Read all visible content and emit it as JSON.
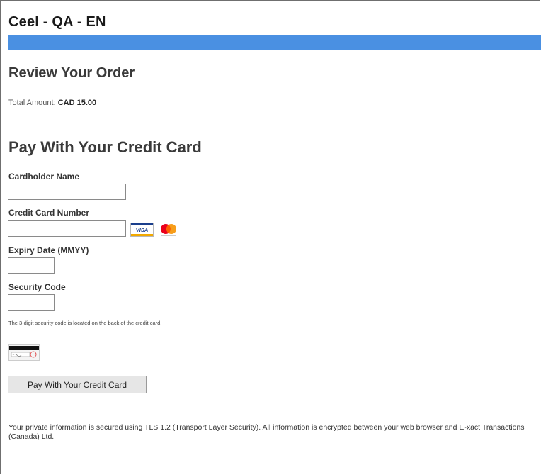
{
  "header": {
    "site_title": "Ceel - QA - EN",
    "accent_color": "#4a90e2"
  },
  "review": {
    "title": "Review Your Order",
    "total_label": "Total Amount:",
    "total_value": "CAD 15.00"
  },
  "payment": {
    "title": "Pay With Your Credit Card",
    "cardholder_label": "Cardholder Name",
    "cardholder_value": "",
    "card_number_label": "Credit Card Number",
    "card_number_value": "",
    "card_brands": [
      "visa-logo-icon",
      "mastercard-logo-icon"
    ],
    "visa_text": "VISA",
    "expiry_label": "Expiry Date (MMYY)",
    "expiry_value": "",
    "security_label": "Security Code",
    "security_value": "",
    "security_note": "The 3-digit security code is located on the back of the credit card.",
    "cvv_icon": "card-back-cvv-icon",
    "submit_label": "Pay With Your Credit Card"
  },
  "footer": {
    "privacy_text": "Your private information is secured using TLS 1.2 (Transport Layer Security). All information is encrypted between your web browser and E-xact Transactions (Canada) Ltd."
  }
}
